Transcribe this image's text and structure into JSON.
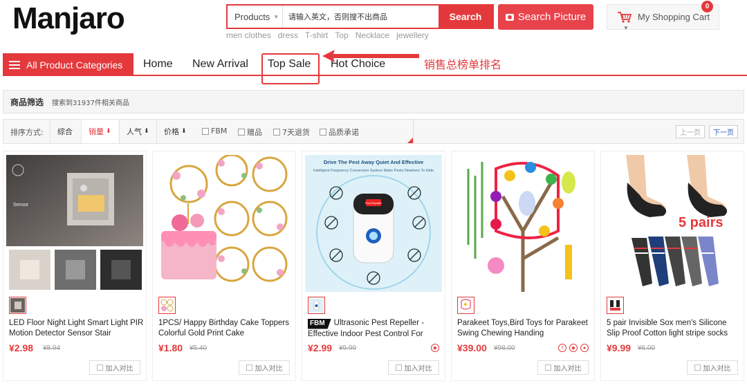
{
  "header": {
    "logo": "Manjaro",
    "search": {
      "category": "Products",
      "placeholder": "请输入英文，否则搜不出商品",
      "button": "Search"
    },
    "search_picture": "Search Picture",
    "hot_words": [
      "men clothes",
      "dress",
      "T-shirt",
      "Top",
      "Necklace",
      "jewellery"
    ],
    "cart": {
      "label": "My Shopping Cart",
      "count": "0"
    }
  },
  "nav": {
    "all_categories": "All Product Categories",
    "items": [
      "Home",
      "New Arrival",
      "Top Sale",
      "Hot Choice"
    ]
  },
  "annotation": {
    "text": "销售总榜单排名",
    "color": "#e4393c"
  },
  "filter": {
    "title": "商品筛选",
    "count_text": "搜索到31937件相关商品"
  },
  "sort": {
    "label": "排序方式:",
    "options": [
      {
        "label": "综合",
        "arrow": ""
      },
      {
        "label": "销量",
        "arrow": "⬇",
        "active": true
      },
      {
        "label": "人气",
        "arrow": "⬇"
      },
      {
        "label": "价格",
        "arrow": "⬇"
      }
    ],
    "checkboxes": [
      "FBM",
      "赠品",
      "7天退货",
      "品质承诺"
    ],
    "prev": "上一页",
    "next": "下一页"
  },
  "products": [
    {
      "title": "LED Floor Night Light Smart Light PIR Motion Detector Sensor Stair",
      "price": "¥2.98",
      "old_price": "¥8.94",
      "compare": "加入对比",
      "image_caption": "Sensor"
    },
    {
      "title": "1PCS/ Happy Birthday Cake Toppers Colorful Gold Print Cake",
      "price": "¥1.80",
      "old_price": "¥5.40",
      "compare": "加入对比"
    },
    {
      "title": "Ultrasonic Pest Repeller - Effective Indoor Pest Control For",
      "badge": "FBM",
      "price": "¥2.99",
      "old_price": "¥9.99",
      "compare": "加入对比",
      "image_caption": "Drive The Pest Away Quiet And Effective",
      "image_sub": "Intelligent Frequency Conversion System Make Pests Nowhere To Hide",
      "device_label": "Pest Repeller"
    },
    {
      "title": "Parakeet Toys,Bird Toys for Parakeet Swing Chewing Handing",
      "price": "¥39.00",
      "old_price": "¥98.00",
      "compare": "加入对比"
    },
    {
      "title": "5 pair Invisible Sox men's Silicone Slip Proof Cotton light stripe socks",
      "price": "¥9.99",
      "old_price": "¥6.00",
      "compare": "加入对比",
      "image_caption": "5 pairs"
    }
  ]
}
